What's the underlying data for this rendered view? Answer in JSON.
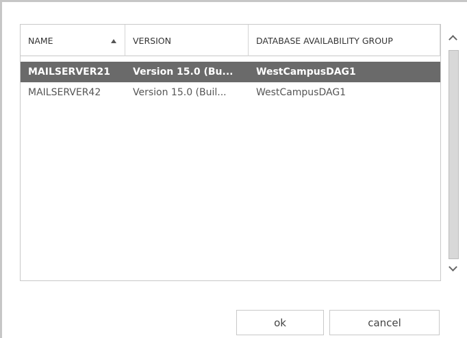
{
  "columns": {
    "name": "NAME",
    "version": "VERSION",
    "dag": "DATABASE AVAILABILITY GROUP"
  },
  "sort": {
    "column": "name",
    "direction": "ascending"
  },
  "rows": [
    {
      "name": "MAILSERVER21",
      "version": "Version 15.0 (Bu...",
      "dag": "WestCampusDAG1",
      "selected": true
    },
    {
      "name": "MAILSERVER42",
      "version": "Version 15.0 (Buil...",
      "dag": "WestCampusDAG1",
      "selected": false
    }
  ],
  "buttons": {
    "ok": "ok",
    "cancel": "cancel"
  },
  "colors": {
    "selected_row": "#6a6a6a",
    "border": "#c8c8c8"
  }
}
